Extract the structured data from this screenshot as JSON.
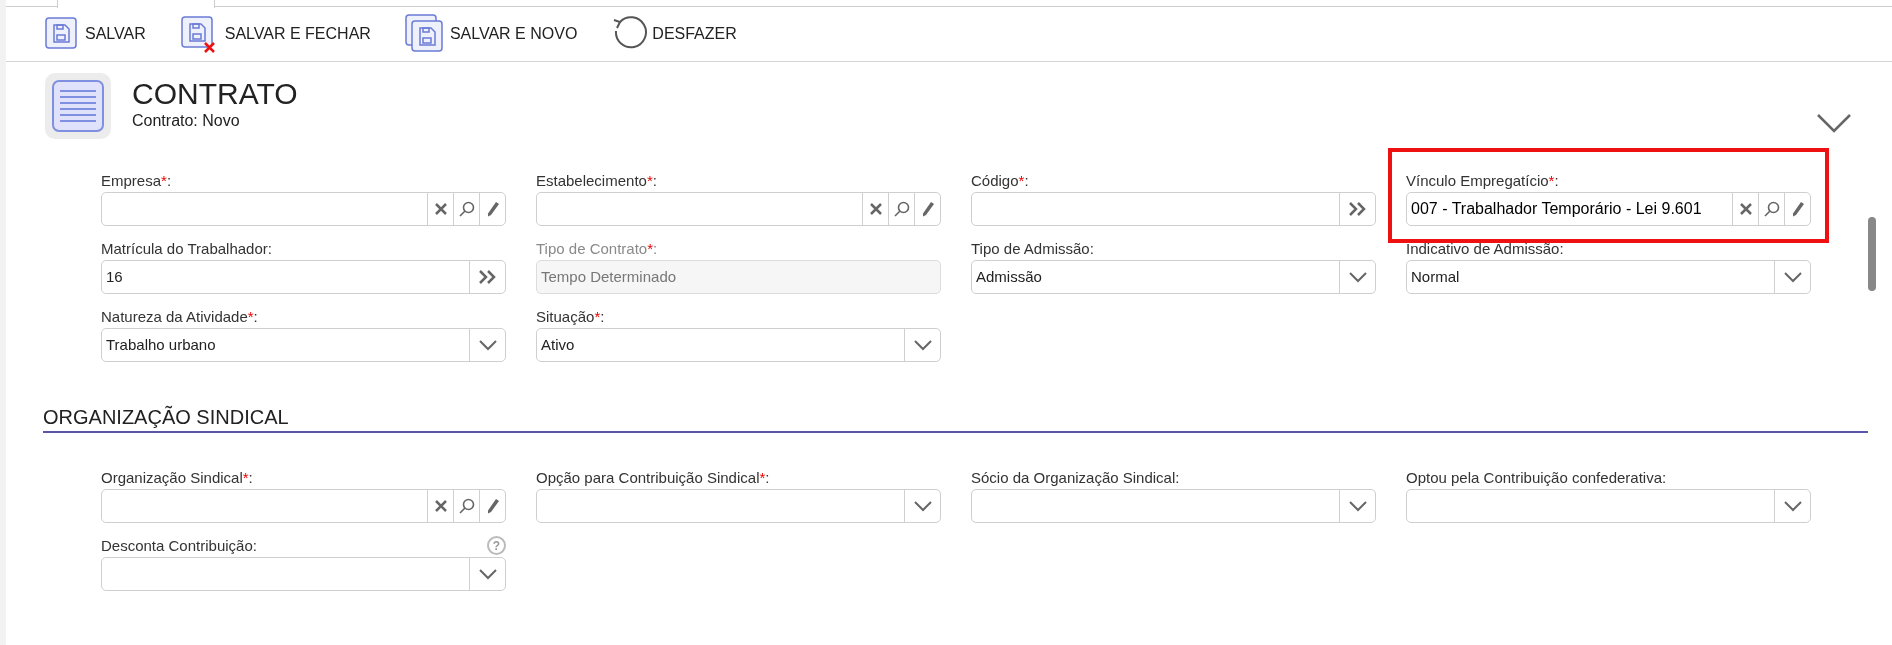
{
  "toolbar": [
    {
      "kind": "save",
      "label": "SALVAR"
    },
    {
      "kind": "save_close",
      "label": "SALVAR E FECHAR"
    },
    {
      "kind": "save_new",
      "label": "SALVAR E NOVO"
    },
    {
      "kind": "undo",
      "label": "DESFAZER"
    }
  ],
  "header": {
    "title": "CONTRATO",
    "subtitle": "Contrato: Novo",
    "expanded": false
  },
  "sections": [
    {
      "rows": [
        [
          {
            "label": "Empresa",
            "required": true,
            "disabled": false,
            "kind": "lookup",
            "highlighted": false,
            "help": false
          },
          {
            "label": "Estabelecimento",
            "required": true,
            "disabled": false,
            "kind": "lookup",
            "highlighted": false,
            "help": false
          },
          {
            "label": "Código",
            "required": true,
            "disabled": false,
            "kind": "code",
            "highlighted": false,
            "help": false
          },
          {
            "label": "Vínculo Empregatício",
            "required": true,
            "disabled": false,
            "kind": "lookup",
            "value": "007 - Trabalhador Temporário - Lei 9.601",
            "highlighted": true,
            "help": false
          }
        ],
        [
          {
            "label": "Matrícula do Trabalhador",
            "required": false,
            "disabled": false,
            "kind": "code",
            "value": "16",
            "highlighted": false,
            "help": false
          },
          {
            "label": "Tipo de Contrato",
            "required": true,
            "disabled": true,
            "kind": "text",
            "value": "Tempo Determinado",
            "highlighted": false,
            "help": false
          },
          {
            "label": "Tipo de Admissão",
            "required": false,
            "disabled": false,
            "kind": "select",
            "value": "Admissão",
            "highlighted": false,
            "help": false
          },
          {
            "label": "Indicativo de Admissão",
            "required": false,
            "disabled": false,
            "kind": "select",
            "value": "Normal",
            "highlighted": false,
            "help": false
          }
        ],
        [
          {
            "label": "Natureza da Atividade",
            "required": true,
            "disabled": false,
            "kind": "select",
            "value": "Trabalho urbano",
            "highlighted": false,
            "help": false
          },
          {
            "label": "Situação",
            "required": true,
            "disabled": false,
            "kind": "select",
            "value": "Ativo",
            "highlighted": false,
            "help": false
          }
        ]
      ]
    },
    {
      "title": "ORGANIZAÇÃO SINDICAL",
      "rows": [
        [
          {
            "label": "Organização Sindical",
            "required": true,
            "disabled": false,
            "kind": "lookup",
            "highlighted": false,
            "help": false
          },
          {
            "label": "Opção para Contribuição Sindical",
            "required": true,
            "disabled": false,
            "kind": "select",
            "highlighted": false,
            "help": false
          },
          {
            "label": "Sócio da Organização Sindical",
            "required": false,
            "disabled": false,
            "kind": "select",
            "highlighted": false,
            "help": false
          },
          {
            "label": "Optou pela Contribuição confederativa",
            "required": false,
            "disabled": false,
            "kind": "select",
            "highlighted": false,
            "help": false
          }
        ],
        [
          {
            "label": "Desconta Contribuição",
            "required": false,
            "disabled": false,
            "kind": "select",
            "highlighted": false,
            "help": true
          }
        ]
      ]
    }
  ],
  "required_mark": "*",
  "label_suffix": ":",
  "help_mark": "?"
}
